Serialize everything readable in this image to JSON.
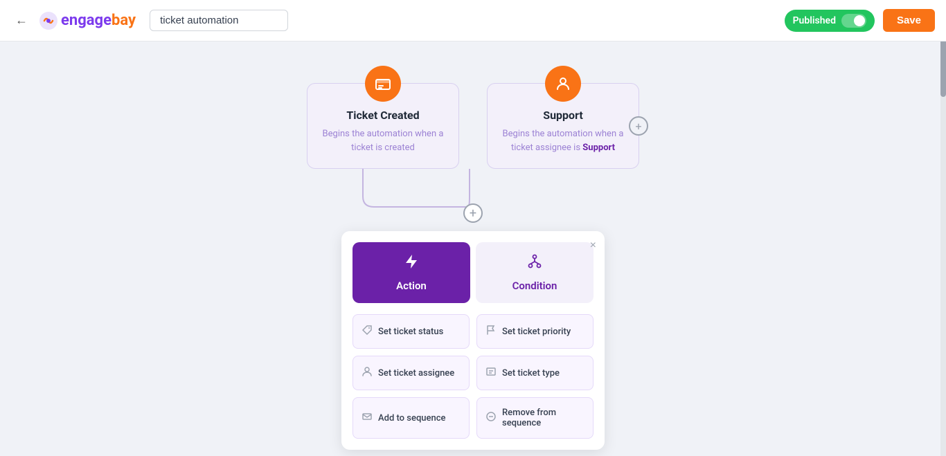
{
  "header": {
    "back_icon": "←",
    "logo_engage": "engage",
    "logo_bay": "bay",
    "title_input_value": "ticket automation",
    "published_label": "Published",
    "save_label": "Save"
  },
  "triggers": [
    {
      "id": "ticket-created",
      "icon": "🎫",
      "title": "Ticket Created",
      "description": "Begins the automation when a ticket is created"
    },
    {
      "id": "support",
      "icon": "👤",
      "title": "Support",
      "description_pre": "Begins the automation when a ticket assignee is ",
      "description_bold": "Support"
    }
  ],
  "panel": {
    "close_icon": "×",
    "tabs": [
      {
        "id": "action",
        "label": "Action",
        "icon": "⚡",
        "active": true
      },
      {
        "id": "condition",
        "label": "Condition",
        "icon": "◎",
        "active": false
      }
    ],
    "actions": [
      {
        "label": "Set ticket status",
        "icon": "🏷"
      },
      {
        "label": "Set ticket priority",
        "icon": "🚩"
      },
      {
        "label": "Set ticket assignee",
        "icon": "👤"
      },
      {
        "label": "Set ticket type",
        "icon": "📋"
      },
      {
        "label": "Add to sequence",
        "icon": "✉"
      },
      {
        "label": "Remove from sequence",
        "icon": "🚫"
      }
    ]
  },
  "colors": {
    "accent_purple": "#6b21a8",
    "accent_orange": "#f97316",
    "published_green": "#22c55e",
    "trigger_icon_bg": "#f97316"
  }
}
